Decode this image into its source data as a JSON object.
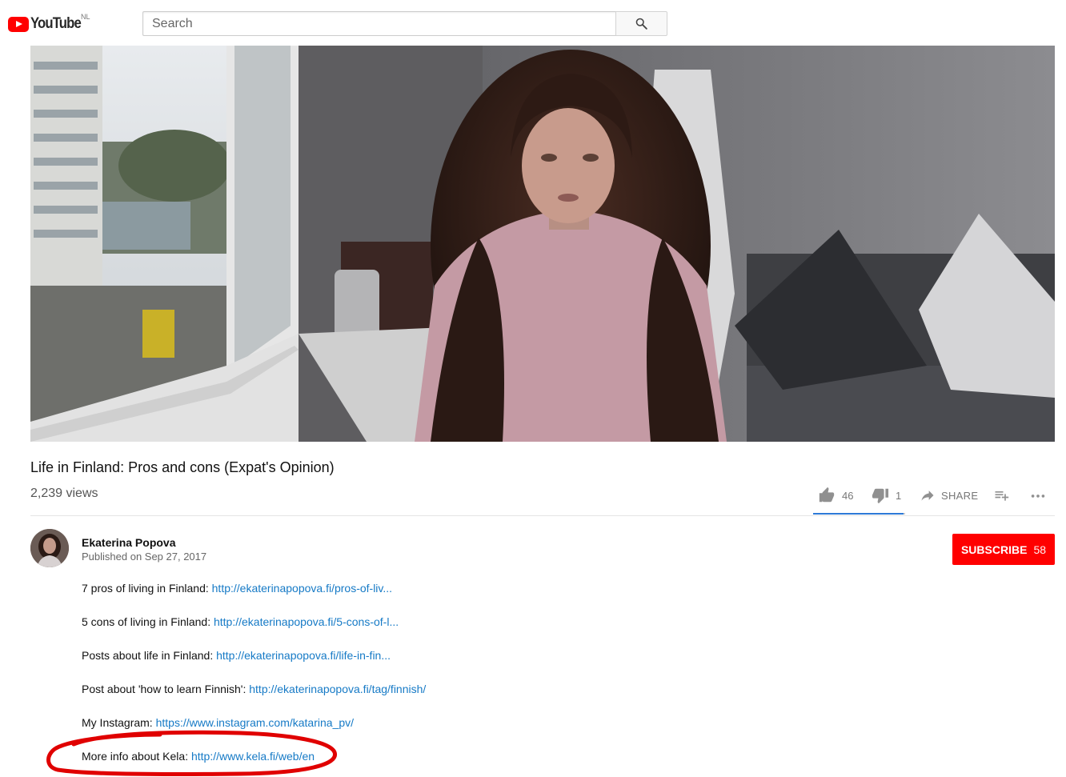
{
  "masthead": {
    "logo_text": "YouTube",
    "country_code": "NL",
    "search_placeholder": "Search",
    "search_icon": "search-icon"
  },
  "video": {
    "title": "Life in Finland: Pros and cons (Expat's Opinion)",
    "views": "2,239 views",
    "likes": "46",
    "dislikes": "1",
    "share_label": "SHARE",
    "like_ratio": 0.98
  },
  "channel": {
    "name": "Ekaterina Popova",
    "published": "Published on Sep 27, 2017",
    "subscribe_label": "SUBSCRIBE",
    "subscriber_count": "58"
  },
  "description": [
    {
      "text": "7 pros of living in Finland: ",
      "link": "http://ekaterinapopova.fi/pros-of-liv..."
    },
    {
      "text": "5 cons of living in Finland: ",
      "link": "http://ekaterinapopova.fi/5-cons-of-l..."
    },
    {
      "text": "Posts about life in Finland: ",
      "link": "http://ekaterinapopova.fi/life-in-fin..."
    },
    {
      "text": "Post about 'how to learn Finnish': ",
      "link": "http://ekaterinapopova.fi/tag/finnish/"
    },
    {
      "text": "My Instagram: ",
      "link": "https://www.instagram.com/katarina_pv/"
    },
    {
      "text": "More info about Kela: ",
      "link": "http://www.kela.fi/web/en"
    }
  ],
  "colors": {
    "brand_red": "#ff0000",
    "link_blue": "#167ac6",
    "annotation_red": "#e00000"
  }
}
